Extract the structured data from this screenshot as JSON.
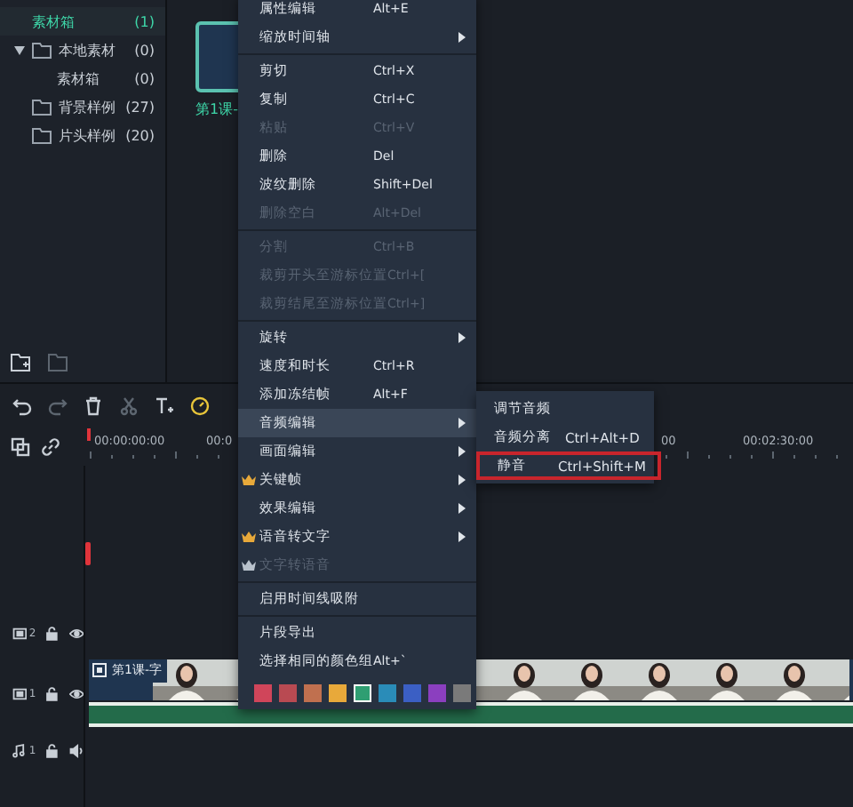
{
  "sidebar": {
    "items": [
      {
        "label": "素材箱",
        "count": "(1)",
        "selected": true
      },
      {
        "label": "本地素材",
        "count": "(0)",
        "selected": false,
        "expanded": true,
        "children": [
          {
            "label": "素材箱",
            "count": "(0)",
            "selected": false
          }
        ]
      },
      {
        "label": "背景样例",
        "count": "(27)",
        "selected": false
      },
      {
        "label": "片头样例",
        "count": "(20)",
        "selected": false
      }
    ]
  },
  "media": {
    "items": [
      {
        "label": "第1课-",
        "selected": true
      }
    ]
  },
  "ruler": {
    "labels": [
      {
        "text": "00:00:00:00"
      },
      {
        "text": "00:0"
      },
      {
        "text": "00"
      },
      {
        "text": "00:02:30:00"
      }
    ]
  },
  "tracks": [
    {
      "kind": "video",
      "number": "2"
    },
    {
      "kind": "video",
      "number": "1",
      "clip": {
        "title": "第1课-字"
      }
    },
    {
      "kind": "audio",
      "number": "1"
    }
  ],
  "context_menu": {
    "items": [
      {
        "kind": "item",
        "label": "属性编辑",
        "shortcut": "Alt+E",
        "disabled": false,
        "submenu": false,
        "vip": false,
        "selected": false
      },
      {
        "kind": "item",
        "label": "缩放时间轴",
        "disabled": false,
        "submenu": true,
        "vip": false,
        "selected": false
      },
      {
        "kind": "divider"
      },
      {
        "kind": "item",
        "label": "剪切",
        "shortcut": "Ctrl+X",
        "disabled": false,
        "submenu": false,
        "vip": false,
        "selected": false
      },
      {
        "kind": "item",
        "label": "复制",
        "shortcut": "Ctrl+C",
        "disabled": false,
        "submenu": false,
        "vip": false,
        "selected": false
      },
      {
        "kind": "item",
        "label": "粘贴",
        "shortcut": "Ctrl+V",
        "disabled": true,
        "submenu": false,
        "vip": false,
        "selected": false
      },
      {
        "kind": "item",
        "label": "删除",
        "shortcut": "Del",
        "disabled": false,
        "submenu": false,
        "vip": false,
        "selected": false
      },
      {
        "kind": "item",
        "label": "波纹删除",
        "shortcut": "Shift+Del",
        "disabled": false,
        "submenu": false,
        "vip": false,
        "selected": false
      },
      {
        "kind": "item",
        "label": "删除空白",
        "shortcut": "Alt+Del",
        "disabled": true,
        "submenu": false,
        "vip": false,
        "selected": false
      },
      {
        "kind": "divider"
      },
      {
        "kind": "item",
        "label": "分割",
        "shortcut": "Ctrl+B",
        "disabled": true,
        "submenu": false,
        "vip": false,
        "selected": false
      },
      {
        "kind": "item",
        "label": "裁剪开头至游标位置",
        "shortcut": "Ctrl+[",
        "disabled": true,
        "submenu": false,
        "vip": false,
        "selected": false
      },
      {
        "kind": "item",
        "label": "裁剪结尾至游标位置",
        "shortcut": "Ctrl+]",
        "disabled": true,
        "submenu": false,
        "vip": false,
        "selected": false
      },
      {
        "kind": "divider"
      },
      {
        "kind": "item",
        "label": "旋转",
        "disabled": false,
        "submenu": true,
        "vip": false,
        "selected": false
      },
      {
        "kind": "item",
        "label": "速度和时长",
        "shortcut": "Ctrl+R",
        "disabled": false,
        "submenu": false,
        "vip": false,
        "selected": false
      },
      {
        "kind": "item",
        "label": "添加冻结帧",
        "shortcut": "Alt+F",
        "disabled": false,
        "submenu": false,
        "vip": false,
        "selected": false
      },
      {
        "kind": "item",
        "label": "音频编辑",
        "disabled": false,
        "submenu": true,
        "vip": false,
        "selected": true
      },
      {
        "kind": "item",
        "label": "画面编辑",
        "disabled": false,
        "submenu": true,
        "vip": false,
        "selected": false
      },
      {
        "kind": "item",
        "label": "关键帧",
        "disabled": false,
        "submenu": true,
        "vip": true,
        "selected": false
      },
      {
        "kind": "item",
        "label": "效果编辑",
        "disabled": false,
        "submenu": true,
        "vip": false,
        "selected": false
      },
      {
        "kind": "item",
        "label": "语音转文字",
        "disabled": false,
        "submenu": true,
        "vip": true,
        "selected": false
      },
      {
        "kind": "item",
        "label": "文字转语音",
        "disabled": true,
        "submenu": false,
        "vip": true,
        "selected": false
      },
      {
        "kind": "divider"
      },
      {
        "kind": "item",
        "label": "启用时间线吸附",
        "disabled": false,
        "submenu": false,
        "vip": false,
        "selected": false
      },
      {
        "kind": "divider"
      },
      {
        "kind": "item",
        "label": "片段导出",
        "disabled": false,
        "submenu": false,
        "vip": false,
        "selected": false
      },
      {
        "kind": "item",
        "label": "选择相同的颜色组",
        "shortcut": "Alt+`",
        "disabled": false,
        "submenu": false,
        "vip": false,
        "selected": false
      },
      {
        "kind": "swatches"
      }
    ]
  },
  "swatches": [
    {
      "color": "#d0455a",
      "selected": false
    },
    {
      "color": "#b94a52",
      "selected": false
    },
    {
      "color": "#c0704f",
      "selected": false
    },
    {
      "color": "#e8a93a",
      "selected": false
    },
    {
      "color": "#2f9e72",
      "selected": true
    },
    {
      "color": "#2a8cb8",
      "selected": false
    },
    {
      "color": "#3b5fc4",
      "selected": false
    },
    {
      "color": "#8b3fbf",
      "selected": false
    },
    {
      "color": "#7a7a7a",
      "selected": false
    }
  ],
  "submenu": {
    "items": [
      {
        "label": "调节音频",
        "highlighted": false
      },
      {
        "label": "音频分离",
        "shortcut": "Ctrl+Alt+D",
        "highlighted": false
      },
      {
        "label": "静音",
        "shortcut": "Ctrl+Shift+M",
        "highlighted": true
      }
    ]
  }
}
